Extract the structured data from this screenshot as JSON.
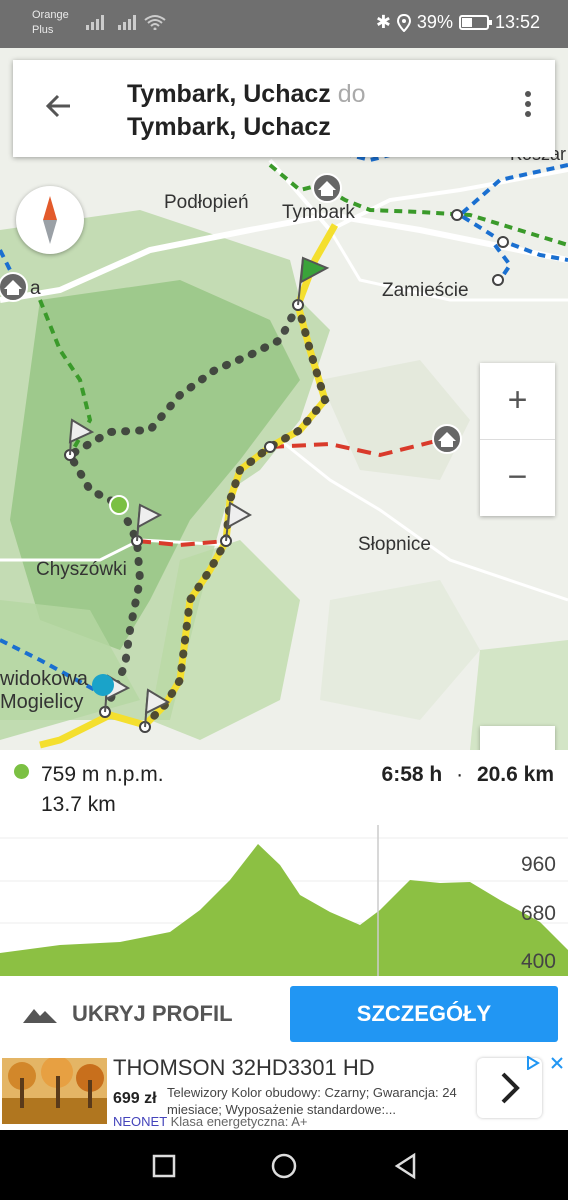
{
  "status_bar": {
    "carrier_line1": "Orange",
    "carrier_line2": "Plus",
    "battery": "39%",
    "time": "13:52"
  },
  "header": {
    "from": "Tymbark, Uchacz",
    "connector": "do",
    "to": "Tymbark, Uchacz"
  },
  "map": {
    "labels": {
      "podlopien": "Podłopień",
      "tymbark": "Tymbark",
      "zamiescie": "Zamieście",
      "slopnice": "Słopnice",
      "chyszowki": "Chyszówki",
      "widokowa": "widokowa",
      "mogielicy": "Mogielicy",
      "edge_a": "a",
      "edge_kosz": "Koszar"
    },
    "zoom_in": "+",
    "zoom_out": "−"
  },
  "profile": {
    "elevation": "759 m n.p.m.",
    "distance_at_point": "13.7 km",
    "duration": "6:58 h",
    "separator": "·",
    "total_distance": "20.6 km",
    "y_ticks": [
      "960",
      "680",
      "400"
    ],
    "fill_color": "#8cc043"
  },
  "actions": {
    "hide_profile": "UKRYJ PROFIL",
    "details": "SZCZEGÓŁY"
  },
  "ad": {
    "title": "THOMSON 32HD3301 HD",
    "price": "699 zł",
    "description": "Telewizory Kolor obudowy: Czarny; Gwarancja: 24 miesiace; Wyposażenie standardowe:...",
    "brand": "NEONET",
    "energy_class": "Klasa energetyczna: A+"
  }
}
